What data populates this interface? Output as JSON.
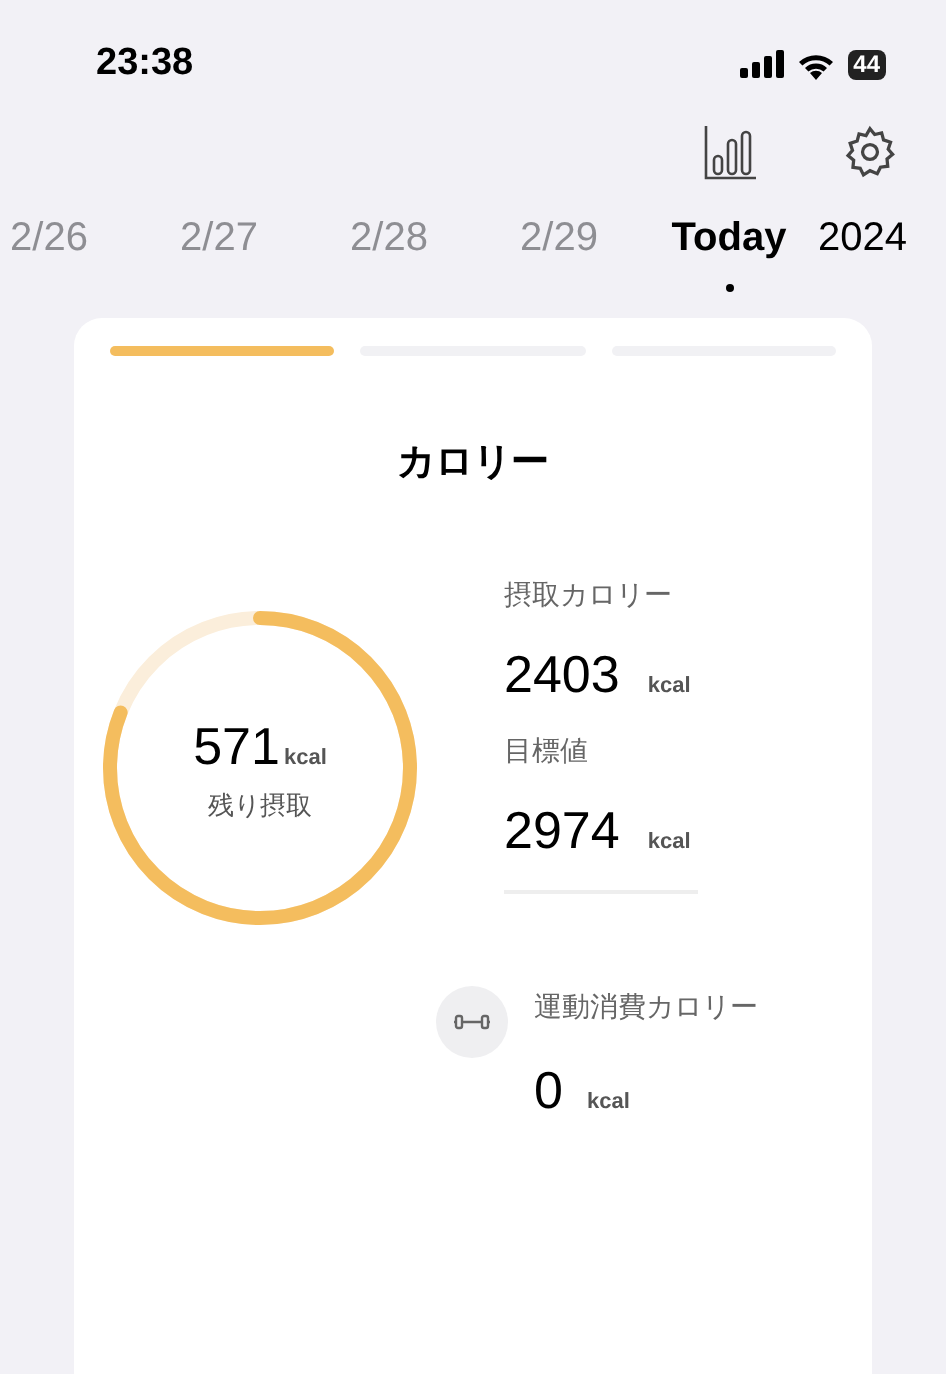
{
  "status_bar": {
    "time": "23:38",
    "battery": "44"
  },
  "dates": [
    {
      "label": "2/26",
      "selected": false
    },
    {
      "label": "2/27",
      "selected": false
    },
    {
      "label": "2/28",
      "selected": false
    },
    {
      "label": "2/29",
      "selected": false
    },
    {
      "label": "Today",
      "selected": true
    }
  ],
  "year": "2024",
  "card": {
    "pages": [
      {
        "selected": true
      },
      {
        "selected": false
      },
      {
        "selected": false
      }
    ],
    "title": "カロリー",
    "ring": {
      "value": "571",
      "unit": "kcal",
      "caption": "残り摂取"
    },
    "stats": [
      {
        "label": "摂取カロリー",
        "value": "2403",
        "unit": "kcal"
      },
      {
        "label": "目標値",
        "value": "2974",
        "unit": "kcal"
      }
    ],
    "exercise": {
      "label": "運動消費カロリー",
      "value": "0",
      "unit": "kcal"
    }
  }
}
